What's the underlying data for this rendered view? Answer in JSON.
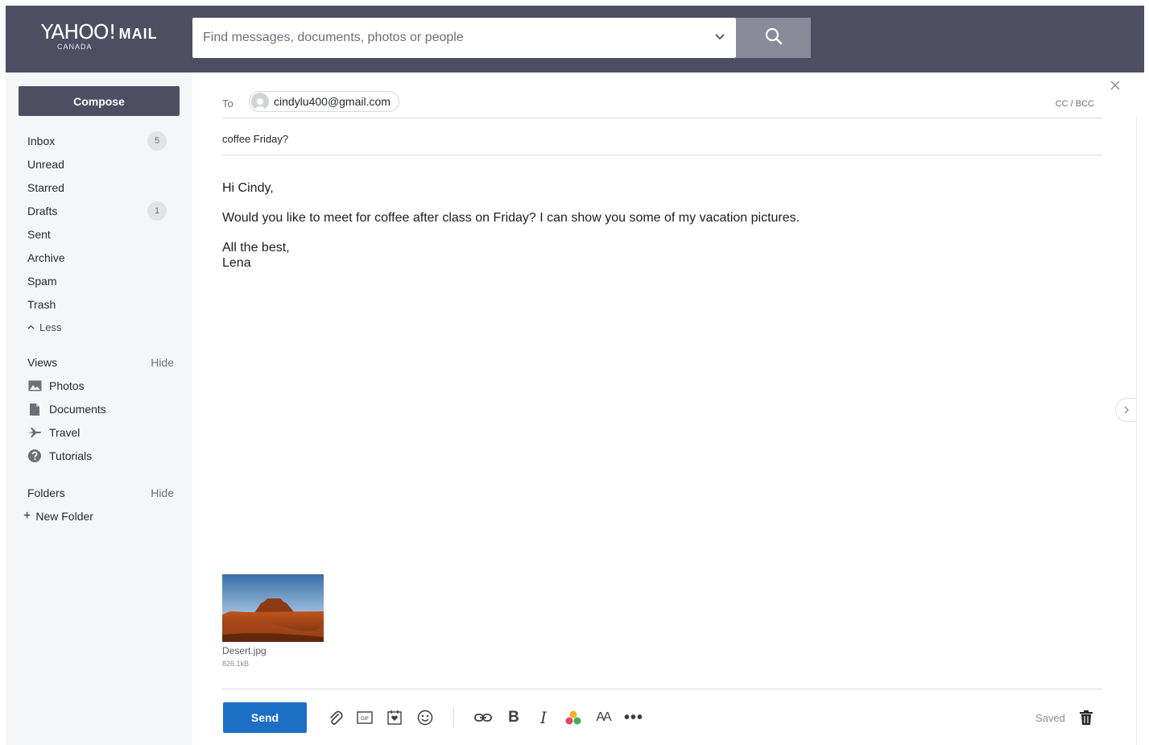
{
  "header": {
    "logo_text": "YAHOO!",
    "logo_suffix": "MAIL",
    "logo_region": "CANADA",
    "search_placeholder": "Find messages, documents, photos or people"
  },
  "sidebar": {
    "compose_label": "Compose",
    "folders": [
      {
        "label": "Inbox",
        "count": "5"
      },
      {
        "label": "Unread",
        "count": ""
      },
      {
        "label": "Starred",
        "count": ""
      },
      {
        "label": "Drafts",
        "count": "1"
      },
      {
        "label": "Sent",
        "count": ""
      },
      {
        "label": "Archive",
        "count": ""
      },
      {
        "label": "Spam",
        "count": ""
      },
      {
        "label": "Trash",
        "count": ""
      }
    ],
    "less_label": "Less",
    "views_label": "Views",
    "views_hide": "Hide",
    "views": [
      {
        "label": "Photos",
        "icon": "photo-icon"
      },
      {
        "label": "Documents",
        "icon": "document-icon"
      },
      {
        "label": "Travel",
        "icon": "plane-icon"
      },
      {
        "label": "Tutorials",
        "icon": "help-icon"
      }
    ],
    "folders_label": "Folders",
    "folders_hide": "Hide",
    "new_folder_label": "New Folder"
  },
  "compose": {
    "to_label": "To",
    "recipient": "cindylu400@gmail.com",
    "cc_bcc": "CC / BCC",
    "subject": "coffee Friday?",
    "body": {
      "greeting": "Hi Cindy,",
      "message": "Would you like to meet for coffee after class on Friday? I can show you some of my vacation pictures.",
      "closing": "All the best,",
      "signature": "Lena"
    },
    "attachment": {
      "name": "Desert.jpg",
      "size": "826.1kB"
    },
    "send_label": "Send",
    "saved_label": "Saved"
  },
  "colors": {
    "header_bg": "#4e4e63",
    "send_button": "#1d6fc6",
    "sidebar_bg": "#f5f6f7"
  }
}
